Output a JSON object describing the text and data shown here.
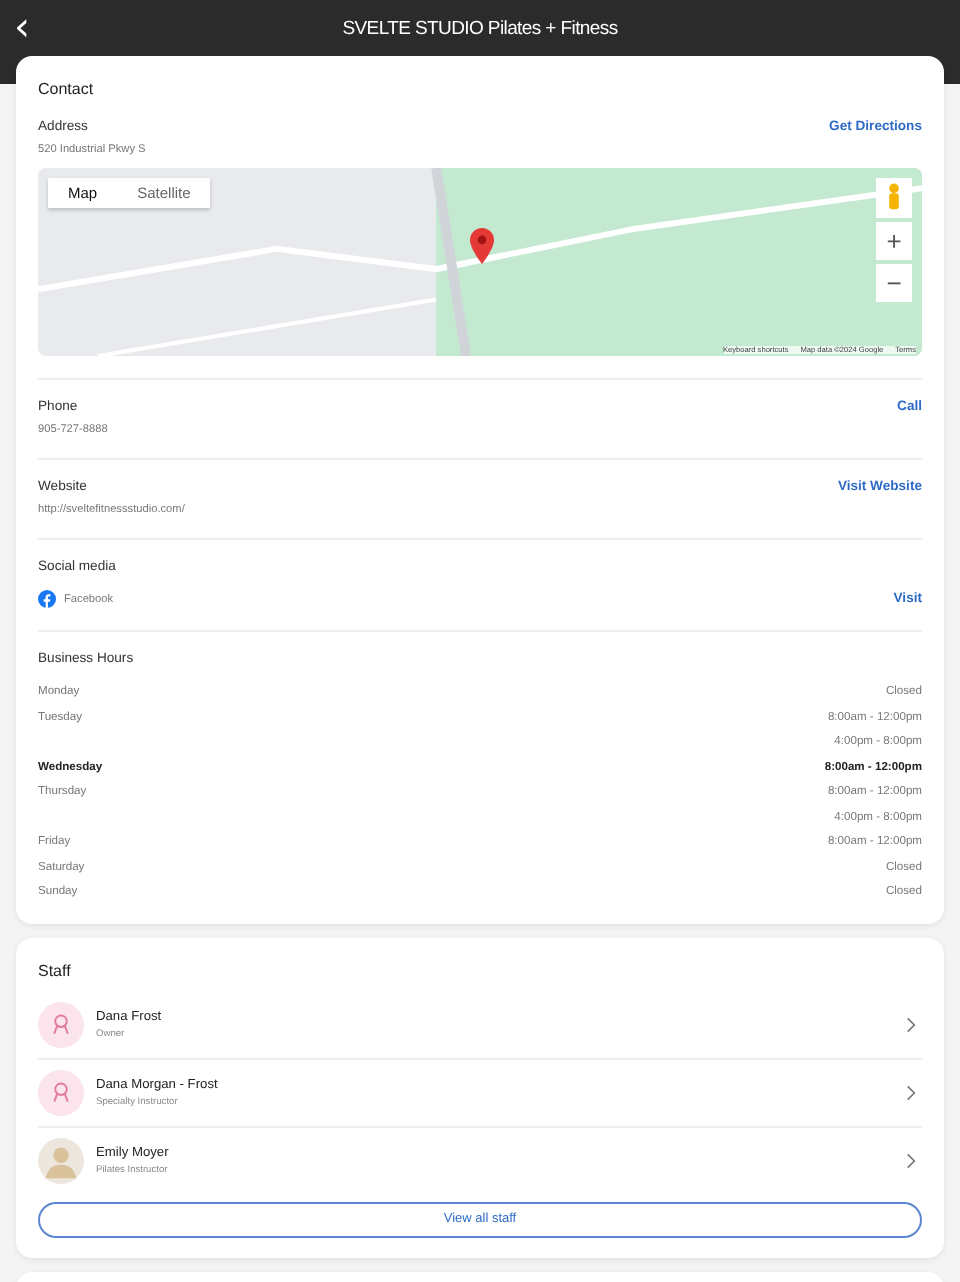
{
  "header": {
    "back": "‹",
    "title": "SVELTE STUDIO Pilates + Fitness"
  },
  "contact": {
    "title": "Contact",
    "address": {
      "label": "Address",
      "value": "520 Industrial Pkwy S",
      "action": "Get Directions"
    },
    "map": {
      "types": [
        {
          "label": "Map",
          "selected": true
        },
        {
          "label": "Satellite",
          "selected": false
        }
      ],
      "zoom_in": "+",
      "zoom_out": "−",
      "attribution": [
        "Keyboard shortcuts",
        "Map data ©2024 Google",
        "Terms"
      ]
    },
    "phone": {
      "label": "Phone",
      "value": "905-727-8888",
      "action": "Call"
    },
    "website": {
      "label": "Website",
      "value": "http://sveltefitnessstudio.com/",
      "action": "Visit Website"
    },
    "social": {
      "label": "Social media",
      "items": [
        {
          "name": "Facebook",
          "action": "Visit"
        }
      ]
    },
    "hours": {
      "title": "Business Hours",
      "days": [
        {
          "day": "Monday",
          "today": false,
          "times": [
            "Closed"
          ]
        },
        {
          "day": "Tuesday",
          "today": false,
          "times": [
            "8:00am - 12:00pm",
            "4:00pm - 8:00pm"
          ]
        },
        {
          "day": "Wednesday",
          "today": true,
          "times": [
            "8:00am - 12:00pm"
          ]
        },
        {
          "day": "Thursday",
          "today": false,
          "times": [
            "8:00am - 12:00pm",
            "4:00pm - 8:00pm"
          ]
        },
        {
          "day": "Friday",
          "today": false,
          "times": [
            "8:00am - 12:00pm"
          ]
        },
        {
          "day": "Saturday",
          "today": false,
          "times": [
            "Closed"
          ]
        },
        {
          "day": "Sunday",
          "today": false,
          "times": [
            "Closed"
          ]
        }
      ]
    }
  },
  "staff": {
    "title": "Staff",
    "members": [
      {
        "name": "Dana Frost",
        "role": "Owner",
        "kind": "placeholder"
      },
      {
        "name": "Dana Morgan - Frost",
        "role": "Specialty Instructor",
        "kind": "placeholder"
      },
      {
        "name": "Emily Moyer",
        "role": "Pilates Instructor",
        "kind": "photo"
      }
    ],
    "action": "View all staff"
  }
}
